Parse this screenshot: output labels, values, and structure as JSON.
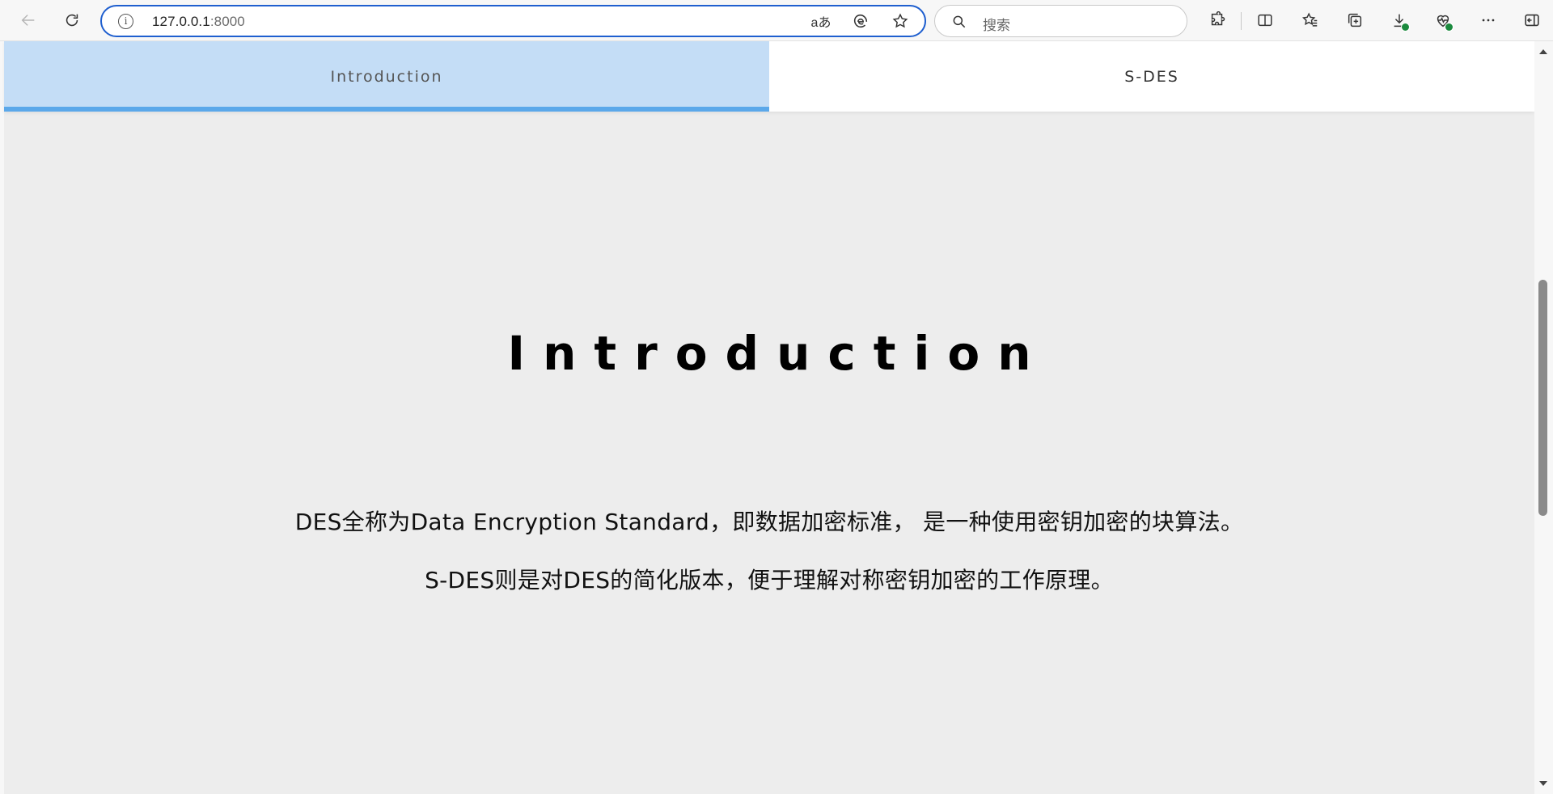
{
  "browser": {
    "url_host": "127.0.0.1",
    "url_port": ":8000",
    "search_placeholder": "搜索",
    "translate_label": "aあ"
  },
  "icons": {
    "back": "back-arrow-icon",
    "reload": "reload-icon",
    "info": "info-icon",
    "translate": "translate-icon",
    "edge": "edge-icon",
    "favorite": "star-icon",
    "search": "search-icon",
    "extensions": "puzzle-icon",
    "split": "split-screen-icon",
    "favorites_list": "favorites-icon",
    "collections": "collections-icon",
    "downloads": "download-icon",
    "health": "browser-essentials-icon",
    "more": "more-icon",
    "sidebar": "sidebar-icon"
  },
  "tabs": [
    {
      "label": "Introduction",
      "active": true
    },
    {
      "label": "S-DES",
      "active": false
    }
  ],
  "main": {
    "heading": "Introduction",
    "paragraphs": [
      "DES全称为Data Encryption Standard，即数据加密标准， 是一种使用密钥加密的块算法。",
      "S-DES则是对DES的简化版本，便于理解对称密钥加密的工作原理。"
    ]
  },
  "colors": {
    "active_tab_bg": "#c4ddf6",
    "active_tab_indicator": "#5ba8ea",
    "page_bg": "#ededed",
    "address_focus": "#1f5fcf"
  }
}
